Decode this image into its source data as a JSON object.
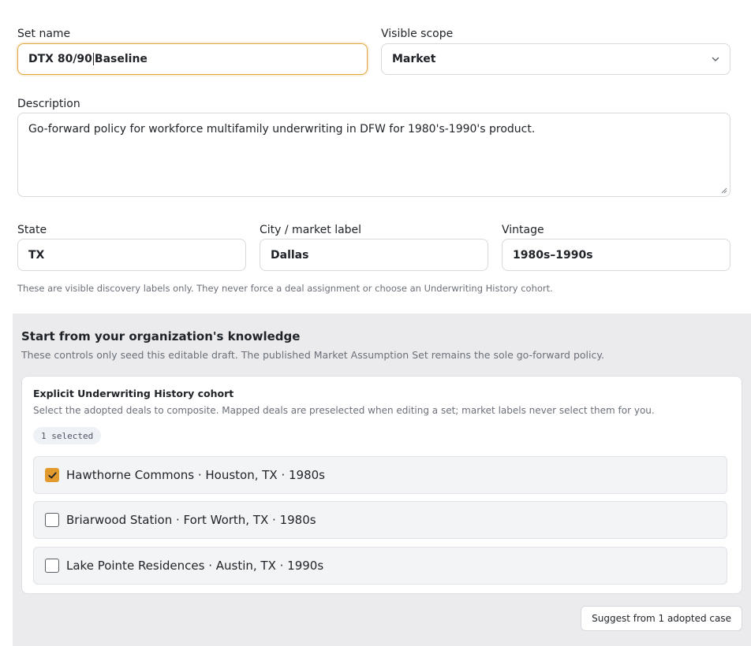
{
  "form": {
    "set_name": {
      "label": "Set name",
      "value_before_caret": "DTX 80/90",
      "value_after_caret": "Baseline"
    },
    "visible_scope": {
      "label": "Visible scope",
      "value": "Market"
    },
    "description": {
      "label": "Description",
      "value": "Go-forward policy for workforce multifamily underwriting in DFW for 1980's-1990's product."
    },
    "state": {
      "label": "State",
      "value": "TX"
    },
    "city": {
      "label": "City / market label",
      "value": "Dallas"
    },
    "vintage": {
      "label": "Vintage",
      "value": "1980s–1990s"
    },
    "labels_hint": "These are visible discovery labels only. They never force a deal assignment or choose an Underwriting History cohort."
  },
  "knowledge": {
    "title": "Start from your organization's knowledge",
    "subtitle": "These controls only seed this editable draft. The published Market Assumption Set remains the sole go-forward policy.",
    "cohort": {
      "title": "Explicit Underwriting History cohort",
      "subtitle": "Select the adopted deals to composite. Mapped deals are preselected when editing a set; market labels never select them for you.",
      "selected_badge": "1 selected",
      "deals": [
        {
          "label": "Hawthorne Commons · Houston, TX · 1980s",
          "checked": true
        },
        {
          "label": "Briarwood Station · Fort Worth, TX · 1980s",
          "checked": false
        },
        {
          "label": "Lake Pointe Residences · Austin, TX · 1990s",
          "checked": false
        }
      ]
    },
    "suggest_button": "Suggest from 1 adopted case"
  },
  "colors": {
    "accent": "#e39a2d",
    "focus_border": "#e0a93f",
    "panel_bg": "#ebebed"
  }
}
